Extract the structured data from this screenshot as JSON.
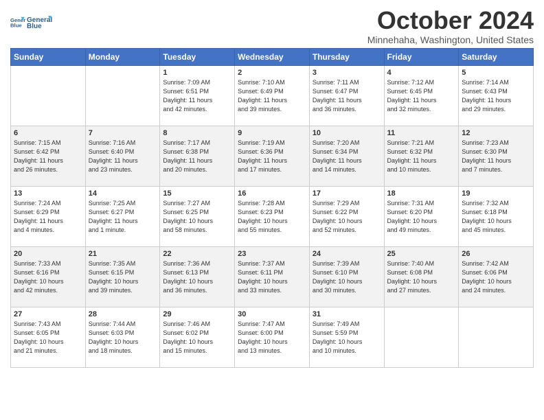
{
  "header": {
    "logo_line1": "General",
    "logo_line2": "Blue",
    "month": "October 2024",
    "location": "Minnehaha, Washington, United States"
  },
  "weekdays": [
    "Sunday",
    "Monday",
    "Tuesday",
    "Wednesday",
    "Thursday",
    "Friday",
    "Saturday"
  ],
  "weeks": [
    [
      {
        "day": "",
        "info": ""
      },
      {
        "day": "",
        "info": ""
      },
      {
        "day": "1",
        "info": "Sunrise: 7:09 AM\nSunset: 6:51 PM\nDaylight: 11 hours\nand 42 minutes."
      },
      {
        "day": "2",
        "info": "Sunrise: 7:10 AM\nSunset: 6:49 PM\nDaylight: 11 hours\nand 39 minutes."
      },
      {
        "day": "3",
        "info": "Sunrise: 7:11 AM\nSunset: 6:47 PM\nDaylight: 11 hours\nand 36 minutes."
      },
      {
        "day": "4",
        "info": "Sunrise: 7:12 AM\nSunset: 6:45 PM\nDaylight: 11 hours\nand 32 minutes."
      },
      {
        "day": "5",
        "info": "Sunrise: 7:14 AM\nSunset: 6:43 PM\nDaylight: 11 hours\nand 29 minutes."
      }
    ],
    [
      {
        "day": "6",
        "info": "Sunrise: 7:15 AM\nSunset: 6:42 PM\nDaylight: 11 hours\nand 26 minutes."
      },
      {
        "day": "7",
        "info": "Sunrise: 7:16 AM\nSunset: 6:40 PM\nDaylight: 11 hours\nand 23 minutes."
      },
      {
        "day": "8",
        "info": "Sunrise: 7:17 AM\nSunset: 6:38 PM\nDaylight: 11 hours\nand 20 minutes."
      },
      {
        "day": "9",
        "info": "Sunrise: 7:19 AM\nSunset: 6:36 PM\nDaylight: 11 hours\nand 17 minutes."
      },
      {
        "day": "10",
        "info": "Sunrise: 7:20 AM\nSunset: 6:34 PM\nDaylight: 11 hours\nand 14 minutes."
      },
      {
        "day": "11",
        "info": "Sunrise: 7:21 AM\nSunset: 6:32 PM\nDaylight: 11 hours\nand 10 minutes."
      },
      {
        "day": "12",
        "info": "Sunrise: 7:23 AM\nSunset: 6:30 PM\nDaylight: 11 hours\nand 7 minutes."
      }
    ],
    [
      {
        "day": "13",
        "info": "Sunrise: 7:24 AM\nSunset: 6:29 PM\nDaylight: 11 hours\nand 4 minutes."
      },
      {
        "day": "14",
        "info": "Sunrise: 7:25 AM\nSunset: 6:27 PM\nDaylight: 11 hours\nand 1 minute."
      },
      {
        "day": "15",
        "info": "Sunrise: 7:27 AM\nSunset: 6:25 PM\nDaylight: 10 hours\nand 58 minutes."
      },
      {
        "day": "16",
        "info": "Sunrise: 7:28 AM\nSunset: 6:23 PM\nDaylight: 10 hours\nand 55 minutes."
      },
      {
        "day": "17",
        "info": "Sunrise: 7:29 AM\nSunset: 6:22 PM\nDaylight: 10 hours\nand 52 minutes."
      },
      {
        "day": "18",
        "info": "Sunrise: 7:31 AM\nSunset: 6:20 PM\nDaylight: 10 hours\nand 49 minutes."
      },
      {
        "day": "19",
        "info": "Sunrise: 7:32 AM\nSunset: 6:18 PM\nDaylight: 10 hours\nand 45 minutes."
      }
    ],
    [
      {
        "day": "20",
        "info": "Sunrise: 7:33 AM\nSunset: 6:16 PM\nDaylight: 10 hours\nand 42 minutes."
      },
      {
        "day": "21",
        "info": "Sunrise: 7:35 AM\nSunset: 6:15 PM\nDaylight: 10 hours\nand 39 minutes."
      },
      {
        "day": "22",
        "info": "Sunrise: 7:36 AM\nSunset: 6:13 PM\nDaylight: 10 hours\nand 36 minutes."
      },
      {
        "day": "23",
        "info": "Sunrise: 7:37 AM\nSunset: 6:11 PM\nDaylight: 10 hours\nand 33 minutes."
      },
      {
        "day": "24",
        "info": "Sunrise: 7:39 AM\nSunset: 6:10 PM\nDaylight: 10 hours\nand 30 minutes."
      },
      {
        "day": "25",
        "info": "Sunrise: 7:40 AM\nSunset: 6:08 PM\nDaylight: 10 hours\nand 27 minutes."
      },
      {
        "day": "26",
        "info": "Sunrise: 7:42 AM\nSunset: 6:06 PM\nDaylight: 10 hours\nand 24 minutes."
      }
    ],
    [
      {
        "day": "27",
        "info": "Sunrise: 7:43 AM\nSunset: 6:05 PM\nDaylight: 10 hours\nand 21 minutes."
      },
      {
        "day": "28",
        "info": "Sunrise: 7:44 AM\nSunset: 6:03 PM\nDaylight: 10 hours\nand 18 minutes."
      },
      {
        "day": "29",
        "info": "Sunrise: 7:46 AM\nSunset: 6:02 PM\nDaylight: 10 hours\nand 15 minutes."
      },
      {
        "day": "30",
        "info": "Sunrise: 7:47 AM\nSunset: 6:00 PM\nDaylight: 10 hours\nand 13 minutes."
      },
      {
        "day": "31",
        "info": "Sunrise: 7:49 AM\nSunset: 5:59 PM\nDaylight: 10 hours\nand 10 minutes."
      },
      {
        "day": "",
        "info": ""
      },
      {
        "day": "",
        "info": ""
      }
    ]
  ]
}
